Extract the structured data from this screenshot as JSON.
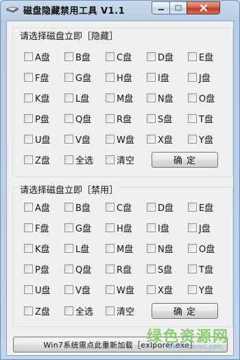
{
  "window": {
    "title": "磁盘隐藏禁用工具 V1.1"
  },
  "hide_group": {
    "title": "请选择磁盘立即［隐藏］",
    "drives": [
      "A盘",
      "B盘",
      "C盘",
      "D盘",
      "E盘",
      "F盘",
      "G盘",
      "H盘",
      "I盘",
      "J盘",
      "K盘",
      "L盘",
      "M盘",
      "N盘",
      "O盘",
      "P盘",
      "Q盘",
      "R盘",
      "S盘",
      "T盘",
      "U盘",
      "V盘",
      "W盘",
      "X盘",
      "Y盘",
      "Z盘"
    ],
    "select_all_label": "全选",
    "clear_label": "清空",
    "confirm_label": "确  定"
  },
  "disable_group": {
    "title": "请选择磁盘立即［禁用］",
    "drives": [
      "A盘",
      "B盘",
      "C盘",
      "D盘",
      "E盘",
      "F盘",
      "G盘",
      "H盘",
      "I盘",
      "J盘",
      "K盘",
      "L盘",
      "M盘",
      "N盘",
      "O盘",
      "P盘",
      "Q盘",
      "R盘",
      "S盘",
      "T盘",
      "U盘",
      "V盘",
      "W盘",
      "X盘",
      "Y盘",
      "Z盘"
    ],
    "select_all_label": "全选",
    "clear_label": "清空",
    "confirm_label": "确  定"
  },
  "reload_button_label": "Win7系统需点此重新加载［exlporer.exe］",
  "watermark": {
    "text": "绿色资源网",
    "url": "www.downcc.com"
  }
}
